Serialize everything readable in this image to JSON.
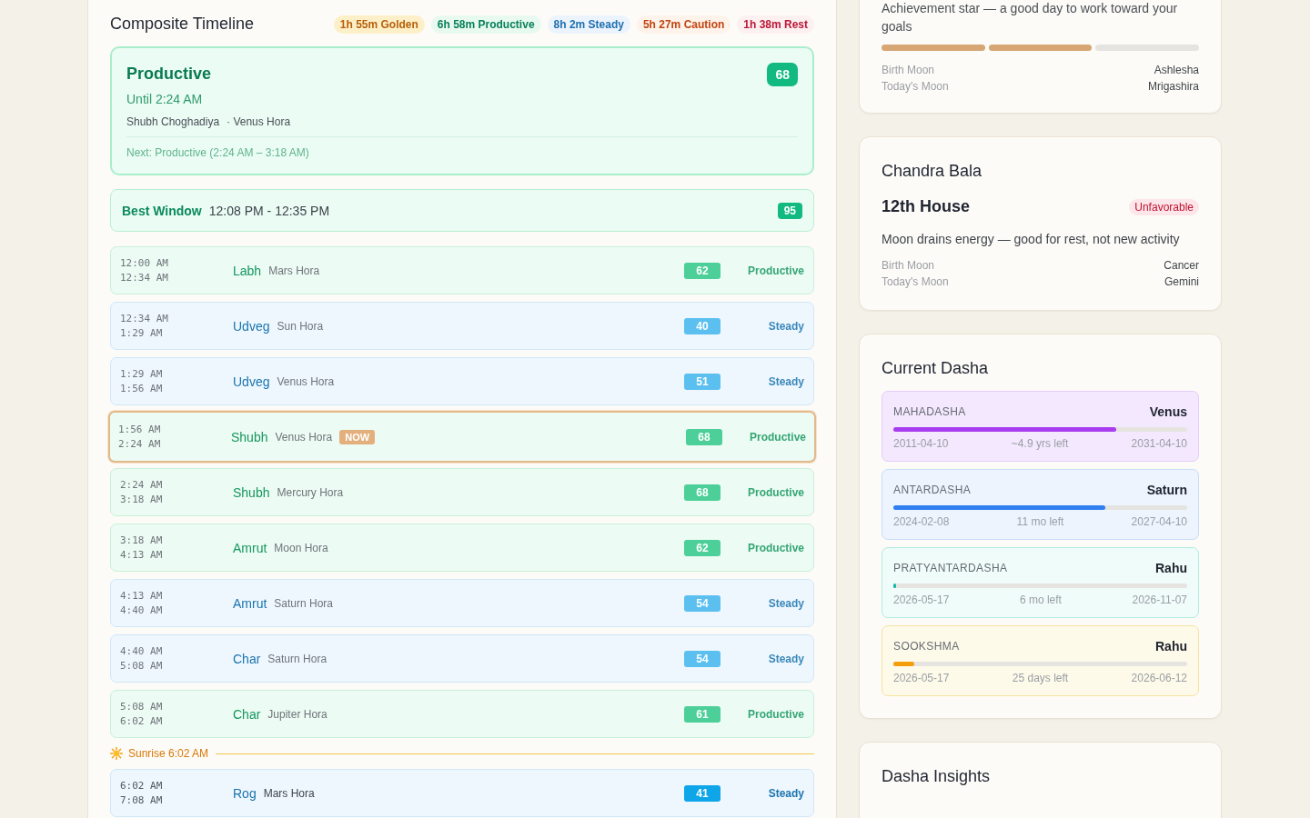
{
  "timeline": {
    "title": "Composite Timeline",
    "summary": [
      {
        "kind": "golden",
        "label": "1h 55m Golden"
      },
      {
        "kind": "productive",
        "label": "6h 58m Productive"
      },
      {
        "kind": "steady",
        "label": "8h 2m Steady"
      },
      {
        "kind": "caution",
        "label": "5h 27m Caution"
      },
      {
        "kind": "rest",
        "label": "1h 38m Rest"
      }
    ],
    "current": {
      "color": "#0a7a52",
      "title": "Productive",
      "until": "Until 2:24 AM",
      "score": "68",
      "choghadiya": "Shubh Choghadiya",
      "hora": "· Venus Hora",
      "next": "Next: Productive (2:24 AM – 3:18 AM)"
    },
    "best_window": {
      "label": "Best Window",
      "time": "12:08 PM - 12:35 PM",
      "score": "95"
    },
    "items": [
      {
        "kind": "slot",
        "color": "#15975f",
        "night": true,
        "selected": false,
        "start": "12:00 AM",
        "end": "12:34 AM",
        "name": "Labh",
        "hora": "Mars Hora",
        "score": "62",
        "label": "Productive"
      },
      {
        "kind": "slot",
        "color": "#1b74ae",
        "night": true,
        "selected": false,
        "start": "12:34 AM",
        "end": "1:29 AM",
        "name": "Udveg",
        "hora": "Sun Hora",
        "score": "40",
        "label": "Steady"
      },
      {
        "kind": "slot",
        "color": "#1b74ae",
        "night": true,
        "selected": false,
        "start": "1:29 AM",
        "end": "1:56 AM",
        "name": "Udveg",
        "hora": "Venus Hora",
        "score": "51",
        "label": "Steady"
      },
      {
        "kind": "slot",
        "color": "#15975f",
        "night": true,
        "selected": true,
        "badge": "NOW",
        "start": "1:56 AM",
        "end": "2:24 AM",
        "name": "Shubh",
        "hora": "Venus Hora",
        "score": "68",
        "label": "Productive"
      },
      {
        "kind": "slot",
        "color": "#15975f",
        "night": true,
        "selected": false,
        "start": "2:24 AM",
        "end": "3:18 AM",
        "name": "Shubh",
        "hora": "Mercury Hora",
        "score": "68",
        "label": "Productive"
      },
      {
        "kind": "slot",
        "color": "#15975f",
        "night": true,
        "selected": false,
        "start": "3:18 AM",
        "end": "4:13 AM",
        "name": "Amrut",
        "hora": "Moon Hora",
        "score": "62",
        "label": "Productive"
      },
      {
        "kind": "slot",
        "color": "#1b74ae",
        "night": true,
        "selected": false,
        "start": "4:13 AM",
        "end": "4:40 AM",
        "name": "Amrut",
        "hora": "Saturn Hora",
        "score": "54",
        "label": "Steady"
      },
      {
        "kind": "slot",
        "color": "#1b74ae",
        "night": true,
        "selected": false,
        "start": "4:40 AM",
        "end": "5:08 AM",
        "name": "Char",
        "hora": "Saturn Hora",
        "score": "54",
        "label": "Steady"
      },
      {
        "kind": "slot",
        "color": "#15975f",
        "night": true,
        "selected": false,
        "start": "5:08 AM",
        "end": "6:02 AM",
        "name": "Char",
        "hora": "Jupiter Hora",
        "score": "61",
        "label": "Productive"
      },
      {
        "kind": "sunrise",
        "label": "Sunrise 6:02 AM"
      },
      {
        "kind": "slot",
        "color": "#1b74ae",
        "night": false,
        "selected": false,
        "start": "6:02 AM",
        "end": "7:08 AM",
        "name": "Rog",
        "hora": "Mars Hora",
        "score": "41",
        "label": "Steady"
      }
    ]
  },
  "nakshatra": {
    "text": "Achievement star — a good day to work toward your goals",
    "segments": [
      {
        "on": true
      },
      {
        "on": true
      },
      {
        "on": false
      }
    ],
    "rows": [
      {
        "label": "Birth Moon",
        "value": "Ashlesha"
      },
      {
        "label": "Today's Moon",
        "value": "Mrigashira"
      }
    ]
  },
  "chandra_bala": {
    "title": "Chandra Bala",
    "house": "12th House",
    "status": {
      "kind": "unfavorable",
      "label": "Unfavorable"
    },
    "text": "Moon drains energy — good for rest, not new activity",
    "rows": [
      {
        "label": "Birth Moon",
        "value": "Cancer"
      },
      {
        "label": "Today's Moon",
        "value": "Gemini"
      }
    ]
  },
  "dasha": {
    "title": "Current Dasha",
    "periods": [
      {
        "kind": "maha",
        "label": "MAHADASHA",
        "planet": "Venus",
        "level": 0.76,
        "start": "2011-04-10",
        "left": "~4.9 yrs left",
        "end": "2031-04-10"
      },
      {
        "kind": "antar",
        "label": "ANTARDASHA",
        "planet": "Saturn",
        "level": 0.72,
        "start": "2024-02-08",
        "left": "11 mo left",
        "end": "2027-04-10"
      },
      {
        "kind": "pratyantar",
        "label": "PRATYANTARDASHA",
        "planet": "Rahu",
        "level": 0.01,
        "start": "2026-05-17",
        "left": "6 mo left",
        "end": "2026-11-07"
      },
      {
        "kind": "sookshma",
        "label": "SOOKSHMA",
        "planet": "Rahu",
        "level": 0.07,
        "start": "2026-05-17",
        "left": "25 days left",
        "end": "2026-06-12"
      }
    ]
  },
  "insights": {
    "title": "Dasha Insights"
  }
}
